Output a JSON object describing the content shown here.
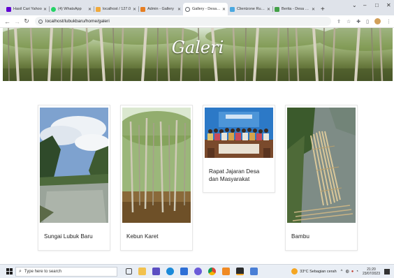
{
  "browser": {
    "tabs": [
      {
        "label": "Hasil Cari Yahoo",
        "favicon_color": "#6001d2",
        "active": false
      },
      {
        "label": "(4) WhatsApp",
        "favicon_color": "#25d366",
        "active": false
      },
      {
        "label": "localhost / 127.0",
        "favicon_color": "#f0a93b",
        "active": false
      },
      {
        "label": "Admin - Gallery",
        "favicon_color": "#e67e22",
        "active": false
      },
      {
        "label": "Gallery - Desa Lu",
        "favicon_color": "#5f6368",
        "active": true
      },
      {
        "label": "Clientzone Rumah",
        "favicon_color": "#4aa8e0",
        "active": false
      },
      {
        "label": "Berita - Desa Kel",
        "favicon_color": "#43a047",
        "active": false
      }
    ],
    "new_tab_symbol": "+",
    "url": "localhost/lubukbaru/home/galeri"
  },
  "page": {
    "title": "Galeri",
    "cards": [
      {
        "caption": "Sungai Lubuk Baru"
      },
      {
        "caption": "Kebun Karet"
      },
      {
        "caption": "Rapat Jajaran Desa dan Masyarakat"
      },
      {
        "caption": "Bambu"
      }
    ]
  },
  "taskbar": {
    "search_placeholder": "Type here to search",
    "weather": "33°C  Sebagian cerah",
    "time": "21:20",
    "date": "23/07/2023"
  }
}
